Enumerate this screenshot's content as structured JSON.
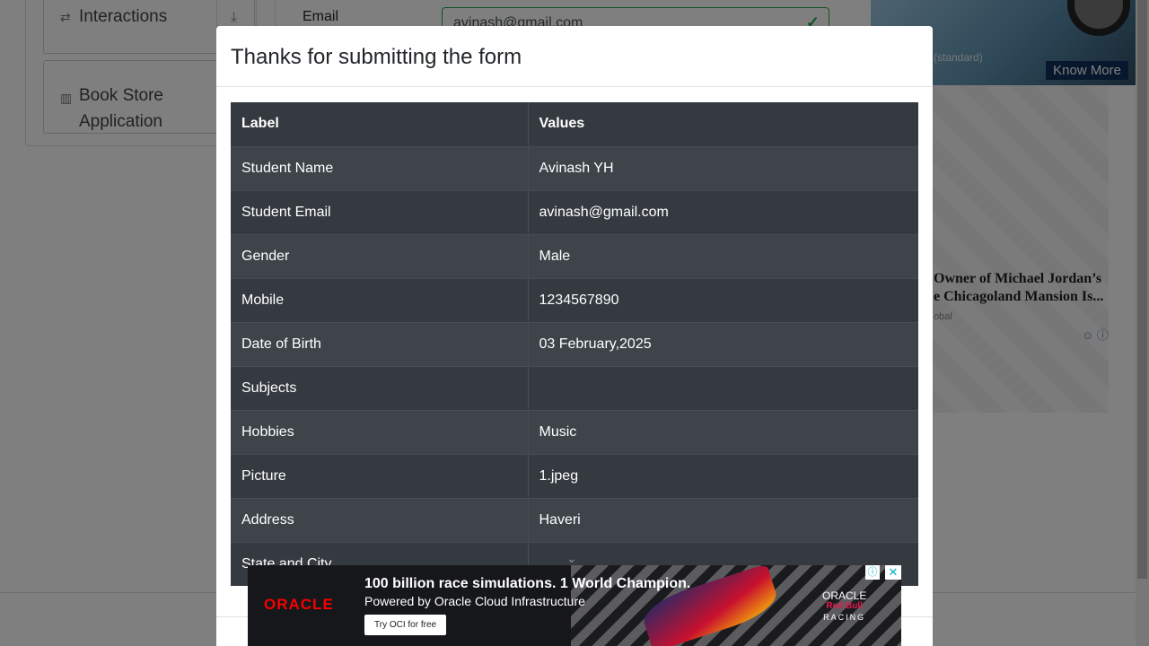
{
  "sidebar": {
    "interactions_label": "Interactions",
    "book_store_label": "Book Store Application"
  },
  "form": {
    "email_label": "Email",
    "email_value": "avinash@gmail.com"
  },
  "right_ad_top": {
    "tag": "(standard)",
    "cta": "Know More"
  },
  "right_ad_mid": {
    "title_line1": "Owner of Michael Jordan’s",
    "title_line2": "e Chicagoland Mansion Is...",
    "source": "obal"
  },
  "modal": {
    "title": "Thanks for submitting the form",
    "columns": [
      "Label",
      "Values"
    ],
    "rows": [
      {
        "label": "Student Name",
        "value": "Avinash YH"
      },
      {
        "label": "Student Email",
        "value": "avinash@gmail.com"
      },
      {
        "label": "Gender",
        "value": "Male"
      },
      {
        "label": "Mobile",
        "value": "1234567890"
      },
      {
        "label": "Date of Birth",
        "value": "03 February,2025"
      },
      {
        "label": "Subjects",
        "value": ""
      },
      {
        "label": "Hobbies",
        "value": "Music"
      },
      {
        "label": "Picture",
        "value": "1.jpeg"
      },
      {
        "label": "Address",
        "value": "Haveri"
      },
      {
        "label": "State and City",
        "value": ""
      }
    ]
  },
  "bottom_ad": {
    "brand": "ORACLE",
    "headline": "100 billion race simulations. 1 World Champion.",
    "subline": "Powered by Oracle Cloud Infrastructure",
    "cta": "Try OCI for free",
    "partner_top": "ORACLE",
    "partner_mid": "Red Bull",
    "partner_bottom": "RACING"
  },
  "colors": {
    "table_dark": "#343a40",
    "table_stripe": "#3e444a",
    "valid_green": "#28a745",
    "backdrop": "rgba(0,0,0,0.5)"
  }
}
